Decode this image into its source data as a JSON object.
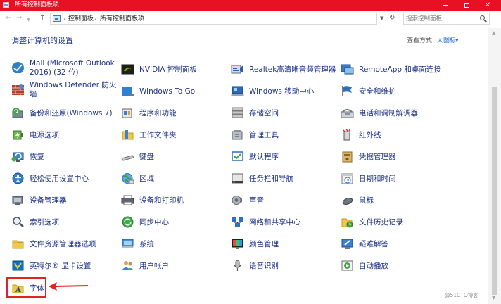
{
  "window": {
    "title": "所有控制面板项",
    "color": "#e81123"
  },
  "nav": {
    "back_icon": "back-arrow-icon",
    "forward_icon": "forward-arrow-icon",
    "up_icon": "up-arrow-icon",
    "breadcrumb": [
      "控制面板",
      "所有控制面板项"
    ],
    "search_placeholder": "搜索控制面板"
  },
  "header": {
    "title": "调整计算机的设置",
    "view_by_label": "查看方式:",
    "view_by_value": "大图标"
  },
  "link_color": "#1e3287",
  "highlight_color": "#e02424",
  "items": [
    {
      "label": "Mail (Microsoft Outlook 2016) (32 位)",
      "icon": "mail-icon"
    },
    {
      "label": "NVIDIA 控制面板",
      "icon": "nvidia-icon"
    },
    {
      "label": "Realtek高清晰音频管理器",
      "icon": "realtek-audio-icon"
    },
    {
      "label": "RemoteApp 和桌面连接",
      "icon": "remoteapp-icon"
    },
    {
      "label": "Windows Defender 防火墙",
      "icon": "firewall-icon"
    },
    {
      "label": "Windows To Go",
      "icon": "windows-to-go-icon"
    },
    {
      "label": "Windows 移动中心",
      "icon": "mobility-center-icon"
    },
    {
      "label": "安全和维护",
      "icon": "security-flag-icon"
    },
    {
      "label": "备份和还原(Windows 7)",
      "icon": "backup-icon"
    },
    {
      "label": "程序和功能",
      "icon": "programs-icon"
    },
    {
      "label": "存储空间",
      "icon": "storage-icon"
    },
    {
      "label": "电话和调制解调器",
      "icon": "phone-modem-icon"
    },
    {
      "label": "电源选项",
      "icon": "power-icon"
    },
    {
      "label": "工作文件夹",
      "icon": "work-folder-icon"
    },
    {
      "label": "管理工具",
      "icon": "admin-tools-icon"
    },
    {
      "label": "红外线",
      "icon": "infrared-icon"
    },
    {
      "label": "恢复",
      "icon": "recovery-icon"
    },
    {
      "label": "键盘",
      "icon": "keyboard-icon"
    },
    {
      "label": "默认程序",
      "icon": "default-programs-icon"
    },
    {
      "label": "凭据管理器",
      "icon": "credential-icon"
    },
    {
      "label": "轻松使用设置中心",
      "icon": "ease-of-access-icon"
    },
    {
      "label": "区域",
      "icon": "region-icon"
    },
    {
      "label": "任务栏和导航",
      "icon": "taskbar-icon"
    },
    {
      "label": "日期和时间",
      "icon": "clock-icon"
    },
    {
      "label": "设备管理器",
      "icon": "device-manager-icon"
    },
    {
      "label": "设备和打印机",
      "icon": "printer-icon"
    },
    {
      "label": "声音",
      "icon": "sound-icon"
    },
    {
      "label": "鼠标",
      "icon": "mouse-icon"
    },
    {
      "label": "索引选项",
      "icon": "indexing-icon"
    },
    {
      "label": "同步中心",
      "icon": "sync-icon"
    },
    {
      "label": "网络和共享中心",
      "icon": "network-icon"
    },
    {
      "label": "文件历史记录",
      "icon": "file-history-icon"
    },
    {
      "label": "文件资源管理器选项",
      "icon": "explorer-options-icon"
    },
    {
      "label": "系统",
      "icon": "system-icon"
    },
    {
      "label": "颜色管理",
      "icon": "color-management-icon"
    },
    {
      "label": "疑难解答",
      "icon": "troubleshooting-icon"
    },
    {
      "label": "英特尔® 显卡设置",
      "icon": "intel-graphics-icon"
    },
    {
      "label": "用户帐户",
      "icon": "user-accounts-icon"
    },
    {
      "label": "语音识别",
      "icon": "microphone-icon"
    },
    {
      "label": "自动播放",
      "icon": "autoplay-icon"
    },
    {
      "label": "字体",
      "icon": "fonts-icon"
    }
  ],
  "watermark": "@51CTO博客"
}
